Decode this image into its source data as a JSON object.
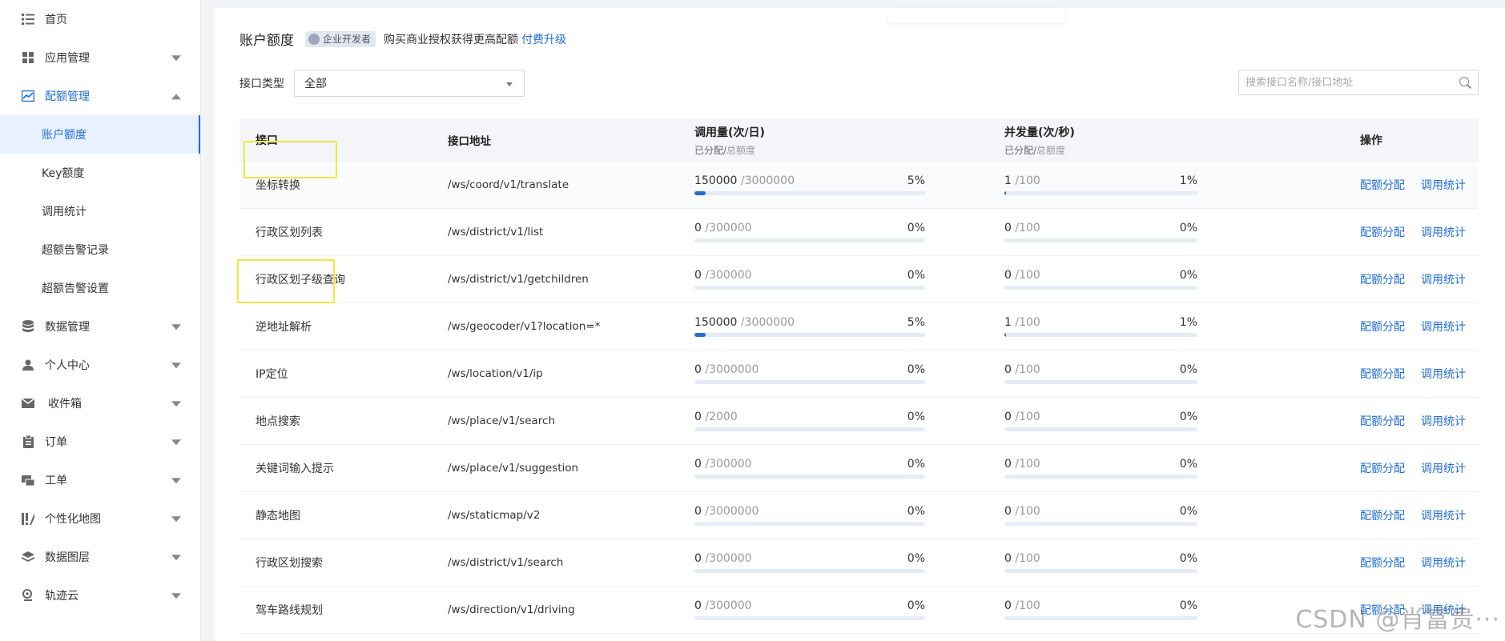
{
  "sidebar": {
    "items": [
      {
        "label": "首页",
        "icon": "list-icon",
        "expandable": false
      },
      {
        "label": "应用管理",
        "icon": "grid-icon",
        "expandable": true
      },
      {
        "label": "配额管理",
        "icon": "chart-icon",
        "expandable": true,
        "expanded": true,
        "children": [
          "账户额度",
          "Key额度",
          "调用统计",
          "超额告警记录",
          "超额告警设置"
        ]
      },
      {
        "label": "数据管理",
        "icon": "database-icon",
        "expandable": true
      },
      {
        "label": "个人中心",
        "icon": "user-icon",
        "expandable": true
      },
      {
        "label": "收件箱",
        "icon": "mail-icon",
        "expandable": true
      },
      {
        "label": "订单",
        "icon": "clipboard-icon",
        "expandable": true
      },
      {
        "label": "工单",
        "icon": "ticket-icon",
        "expandable": true
      },
      {
        "label": "个性化地图",
        "icon": "map-style-icon",
        "expandable": true
      },
      {
        "label": "数据图层",
        "icon": "layers-icon",
        "expandable": true
      },
      {
        "label": "轨迹云",
        "icon": "location-icon",
        "expandable": true
      }
    ],
    "active_child": "账户额度"
  },
  "header": {
    "title": "账户额度",
    "badge": "企业开发者",
    "promo": "购买商业授权获得更高配额",
    "upgrade_link": "付费升级"
  },
  "filter": {
    "label": "接口类型",
    "selected": "全部"
  },
  "search": {
    "placeholder": "搜索接口名称/接口地址"
  },
  "table": {
    "headers": {
      "api": "接口",
      "address": "接口地址",
      "calls": "调用量(次/日)",
      "calls_sub_a": "已分配/",
      "calls_sub_b": "总额度",
      "concurrency": "并发量(次/秒)",
      "conc_sub_a": "已分配/",
      "conc_sub_b": "总额度",
      "ops": "操作"
    },
    "op_labels": [
      "配额分配",
      "调用统计"
    ],
    "rows": [
      {
        "name": "坐标转换",
        "address": "/ws/coord/v1/translate",
        "calls_used": "150000",
        "calls_total": "/3000000",
        "calls_pct": "5%",
        "calls_frac": 0.05,
        "conc_used": "1",
        "conc_total": "/100",
        "conc_pct": "1%",
        "conc_frac": 0.01
      },
      {
        "name": "行政区划列表",
        "address": "/ws/district/v1/list",
        "calls_used": "0",
        "calls_total": "/300000",
        "calls_pct": "0%",
        "calls_frac": 0,
        "conc_used": "0",
        "conc_total": "/100",
        "conc_pct": "0%",
        "conc_frac": 0
      },
      {
        "name": "行政区划子级查询",
        "address": "/ws/district/v1/getchildren",
        "calls_used": "0",
        "calls_total": "/300000",
        "calls_pct": "0%",
        "calls_frac": 0,
        "conc_used": "0",
        "conc_total": "/100",
        "conc_pct": "0%",
        "conc_frac": 0
      },
      {
        "name": "逆地址解析",
        "address": "/ws/geocoder/v1?location=*",
        "calls_used": "150000",
        "calls_total": "/3000000",
        "calls_pct": "5%",
        "calls_frac": 0.05,
        "conc_used": "1",
        "conc_total": "/100",
        "conc_pct": "1%",
        "conc_frac": 0.01
      },
      {
        "name": "IP定位",
        "address": "/ws/location/v1/ip",
        "calls_used": "0",
        "calls_total": "/3000000",
        "calls_pct": "0%",
        "calls_frac": 0,
        "conc_used": "0",
        "conc_total": "/100",
        "conc_pct": "0%",
        "conc_frac": 0
      },
      {
        "name": "地点搜索",
        "address": "/ws/place/v1/search",
        "calls_used": "0",
        "calls_total": "/2000",
        "calls_pct": "0%",
        "calls_frac": 0,
        "conc_used": "0",
        "conc_total": "/100",
        "conc_pct": "0%",
        "conc_frac": 0
      },
      {
        "name": "关键词输入提示",
        "address": "/ws/place/v1/suggestion",
        "calls_used": "0",
        "calls_total": "/300000",
        "calls_pct": "0%",
        "calls_frac": 0,
        "conc_used": "0",
        "conc_total": "/100",
        "conc_pct": "0%",
        "conc_frac": 0
      },
      {
        "name": "静态地图",
        "address": "/ws/staticmap/v2",
        "calls_used": "0",
        "calls_total": "/3000000",
        "calls_pct": "0%",
        "calls_frac": 0,
        "conc_used": "0",
        "conc_total": "/100",
        "conc_pct": "0%",
        "conc_frac": 0
      },
      {
        "name": "行政区划搜索",
        "address": "/ws/district/v1/search",
        "calls_used": "0",
        "calls_total": "/300000",
        "calls_pct": "0%",
        "calls_frac": 0,
        "conc_used": "0",
        "conc_total": "/100",
        "conc_pct": "0%",
        "conc_frac": 0
      },
      {
        "name": "驾车路线规划",
        "address": "/ws/direction/v1/driving",
        "calls_used": "0",
        "calls_total": "/300000",
        "calls_pct": "0%",
        "calls_frac": 0,
        "conc_used": "0",
        "conc_total": "/100",
        "conc_pct": "0%",
        "conc_frac": 0
      }
    ]
  },
  "watermark": "CSDN @肖富贵···",
  "colors": {
    "accent": "#1e6fe0",
    "highlight_box": "#f2e83a"
  }
}
